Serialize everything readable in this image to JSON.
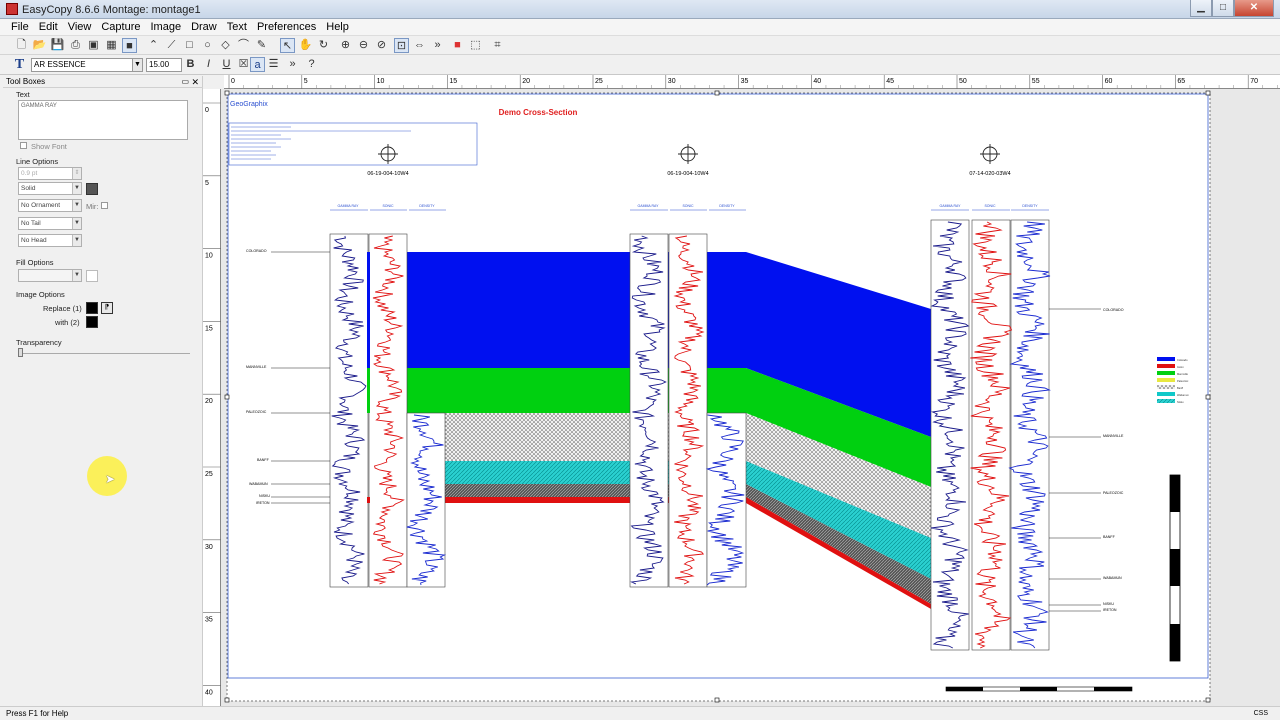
{
  "window": {
    "title": "EasyCopy 8.6.6 Montage: montage1"
  },
  "menu": [
    "File",
    "Edit",
    "View",
    "Capture",
    "Image",
    "Draw",
    "Text",
    "Preferences",
    "Help"
  ],
  "font_toolbar": {
    "font": "AR ESSENCE",
    "size": "15.00"
  },
  "toolboxes": {
    "title": "Tool Boxes",
    "text_label": "Text",
    "text_value": "GAMMA RAY",
    "show_font": "Show Font",
    "line_options": "Line Options",
    "line_width": "0.9 pt",
    "line_style": "Solid",
    "ornament": "No Ornament",
    "mir": "Mir:",
    "tail": "No Tail",
    "head": "No Head",
    "fill_options": "Fill Options",
    "image_options": "Image Options",
    "replace": "Replace (1)",
    "with": "with (2)",
    "transparency": "Transparency"
  },
  "ruler_h": [
    "0",
    "5",
    "10",
    "15",
    "20",
    "25",
    "30",
    "35",
    "40",
    "45",
    "50",
    "55",
    "60",
    "65",
    "70"
  ],
  "ruler_v": [
    "0",
    "5",
    "10",
    "15",
    "20",
    "25",
    "30",
    "35",
    "40"
  ],
  "document": {
    "brand": "GeoGraphix",
    "title": "Demo Cross-Section",
    "wells": [
      "06-19-004-10W4",
      "06-19-004-10W4",
      "07-14-020-03W4"
    ],
    "track_headers": [
      "GAMMA RAY",
      "SONIC",
      "DENSITY"
    ],
    "left_formations": [
      "COLORADO",
      "MANNVILLE",
      "PALEOZOIC",
      "BANFF",
      "WABAMUN",
      "NISKU",
      "IRETON"
    ],
    "right_formations": [
      "COLORADO",
      "MANNVILLE",
      "PALEOZOIC",
      "BANFF",
      "WABAMUN",
      "NISKU",
      "IRETON"
    ],
    "legend": [
      "Colorado",
      "Mannville",
      "Paleozoic",
      "Banff",
      "Wabamun",
      "Nisku",
      "Ireton"
    ]
  },
  "colors": {
    "colorado": "#0010f0",
    "mannville": "#00d010",
    "banff": "#10c8c8",
    "ireton": "#e01010",
    "title_red": "#e02020"
  },
  "status": {
    "help": "Press F1 for Help",
    "mode": "CSS"
  }
}
